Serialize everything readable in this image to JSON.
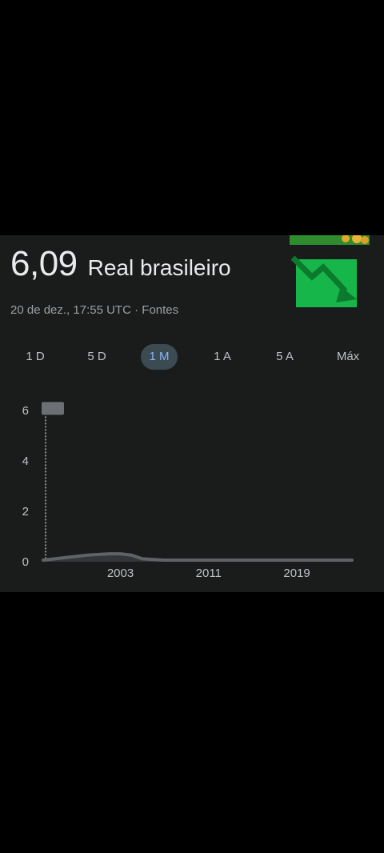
{
  "quote": {
    "value": "6,09",
    "currency": "Real brasileiro",
    "timestamp": "20 de dez., 17:55 UTC",
    "separator": " · ",
    "sources_link": "Fontes"
  },
  "decoration": {
    "icon": "chart-decreasing-emoji",
    "accent_color": "#19b84a"
  },
  "range_tabs": [
    {
      "label": "1 D",
      "active": false
    },
    {
      "label": "5 D",
      "active": false
    },
    {
      "label": "1 M",
      "active": true
    },
    {
      "label": "1 A",
      "active": false
    },
    {
      "label": "5 A",
      "active": false
    },
    {
      "label": "Máx",
      "active": false
    }
  ],
  "chart_data": {
    "type": "line",
    "x_tick_labels": [
      "2003",
      "2011",
      "2019"
    ],
    "y_tick_labels": [
      "0",
      "2",
      "4",
      "6"
    ],
    "ylim": [
      0,
      6.1
    ],
    "xlim": [
      1996,
      2024
    ],
    "grid": false,
    "series": [
      {
        "x": [
          1996,
          1998,
          2000,
          2002,
          2003,
          2004,
          2005,
          2007,
          2011,
          2015,
          2019,
          2024
        ],
        "y": [
          0.0,
          0.1,
          0.2,
          0.25,
          0.25,
          0.2,
          0.05,
          0.0,
          0.0,
          0.0,
          0.0,
          0.0
        ]
      }
    ],
    "spike": {
      "x": 1996,
      "y": 6.09
    },
    "line_color": "#5f6368",
    "fill_color": "#3a3f44"
  }
}
